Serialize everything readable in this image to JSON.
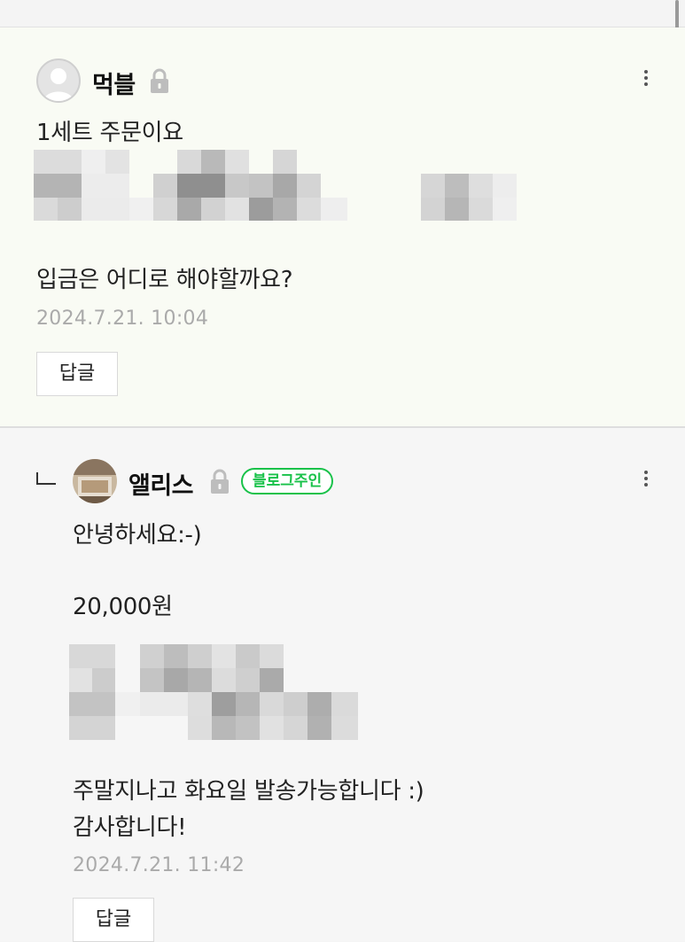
{
  "comments": [
    {
      "author": "먹블",
      "text_line1": "1세트 주문이요",
      "text_line2": "입금은 어디로 해야할까요?",
      "date": "2024.7.21. 10:04",
      "reply_label": "답글"
    },
    {
      "author": "앨리스",
      "owner_badge": "블로그주인",
      "text_line1": "안녕하세요:-)",
      "text_line2": "20,000원",
      "text_line3": "주말지나고 화요일 발송가능합니다 :)",
      "text_line4": "감사합니다!",
      "date": "2024.7.21. 11:42",
      "reply_label": "답글"
    }
  ],
  "icons": {
    "lock": "lock-icon",
    "more": "more-vertical-icon",
    "reply_indicator": "reply-arrow-icon",
    "default_avatar": "person-icon"
  },
  "colors": {
    "owner_badge": "#19c24a",
    "date_text": "#aaaaaa",
    "first_comment_bg": "#f9fbf4"
  }
}
